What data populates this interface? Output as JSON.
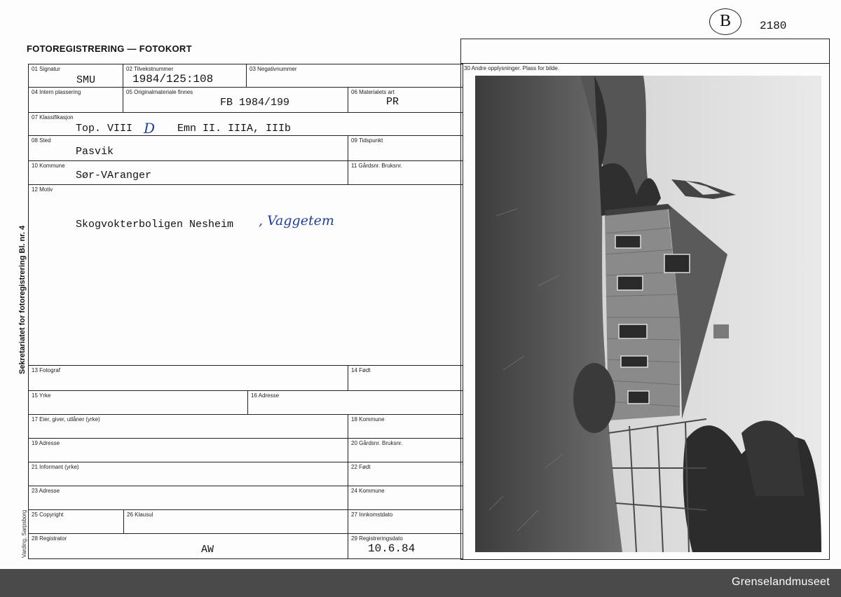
{
  "header": {
    "title": "FOTOREGISTRERING — FOTOKORT",
    "corner_mark": "B",
    "corner_number": "2180"
  },
  "side": {
    "title": "Sekretariatet for fotoregistrering Bl. nr. 4",
    "printer": "Varding, Sarpsborg"
  },
  "fields": {
    "f01": {
      "label": "01 Signatur",
      "value": "SMU"
    },
    "f02": {
      "label": "02 Tilvekstnummer",
      "value": "1984/125:108"
    },
    "f03": {
      "label": "03 Negativnummer",
      "value": ""
    },
    "f04": {
      "label": "04 Intern plassering",
      "value": ""
    },
    "f05": {
      "label": "05 Originalmateriale finnes",
      "value": "FB 1984/199"
    },
    "f06": {
      "label": "06 Materialets art",
      "value": "PR"
    },
    "f07": {
      "label": "07 Klassifikasjon",
      "value_a": "Top. VIII",
      "hand": "D",
      "value_b": "Emn II. IIIA, IIIb"
    },
    "f08": {
      "label": "08 Sted",
      "value": "Pasvik"
    },
    "f09": {
      "label": "09 Tidspunkt",
      "value": ""
    },
    "f10": {
      "label": "10 Kommune",
      "value": "Sør-VAranger"
    },
    "f11": {
      "label": "11 Gårdsnr. Bruksnr.",
      "value": ""
    },
    "f12": {
      "label": "12 Motiv",
      "value": "Skogvokterboligen Nesheim",
      "hand": ", Vaggetem"
    },
    "f13": {
      "label": "13 Fotograf",
      "value": ""
    },
    "f14": {
      "label": "14 Født",
      "value": ""
    },
    "f15": {
      "label": "15 Yrke",
      "value": ""
    },
    "f16": {
      "label": "16 Adresse",
      "value": ""
    },
    "f17": {
      "label": "17 Eier, giver, utlåner (yrke)",
      "value": ""
    },
    "f18": {
      "label": "18 Kommune",
      "value": ""
    },
    "f19": {
      "label": "19 Adresse",
      "value": ""
    },
    "f20": {
      "label": "20 Gårdsnr. Bruksnr.",
      "value": ""
    },
    "f21": {
      "label": "21 Informant (yrke)",
      "value": ""
    },
    "f22": {
      "label": "22 Født",
      "value": ""
    },
    "f23": {
      "label": "23 Adresse",
      "value": ""
    },
    "f24": {
      "label": "24 Kommune",
      "value": ""
    },
    "f25": {
      "label": "25 Copyright",
      "value": ""
    },
    "f26": {
      "label": "26 Klausul",
      "value": ""
    },
    "f27": {
      "label": "27 Innkomstdato",
      "value": ""
    },
    "f28": {
      "label": "28 Registrator",
      "value": "AW"
    },
    "f29": {
      "label": "29 Registreringsdato",
      "value": "10.6.84"
    },
    "f30": {
      "label": "30 Andre opplysninger. Plass for bilde."
    }
  },
  "footer": {
    "text": "Grenselandmuseet"
  }
}
